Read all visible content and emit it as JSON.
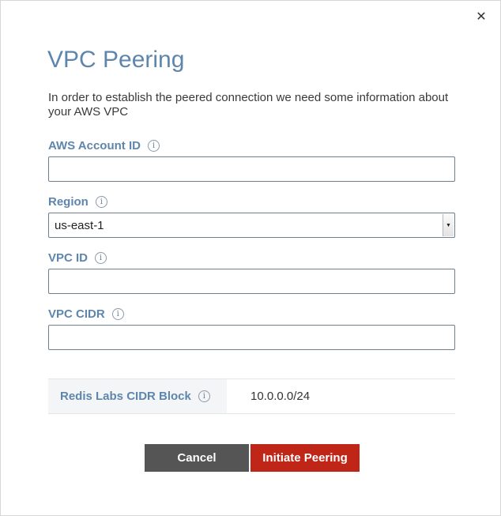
{
  "dialog": {
    "close_glyph": "✕",
    "title": "VPC Peering",
    "intro": "In order to establish the peered connection we need some information about your AWS VPC"
  },
  "fields": {
    "aws_account_id": {
      "label": "AWS Account ID",
      "value": "",
      "info_icon": "info-icon"
    },
    "region": {
      "label": "Region",
      "value": "us-east-1",
      "info_icon": "info-icon"
    },
    "vpc_id": {
      "label": "VPC ID",
      "value": "",
      "info_icon": "info-icon"
    },
    "vpc_cidr": {
      "label": "VPC CIDR",
      "value": "",
      "info_icon": "info-icon"
    }
  },
  "cidr_block": {
    "label": "Redis Labs CIDR Block",
    "value": "10.0.0.0/24"
  },
  "buttons": {
    "cancel": "Cancel",
    "initiate": "Initiate Peering"
  },
  "info_glyph": "i",
  "select_arrow_glyph": "▼",
  "colors": {
    "title": "#5e86ac",
    "label": "#5e86ac",
    "cancel_button": "#555555",
    "initiate_button": "#bf2617"
  }
}
